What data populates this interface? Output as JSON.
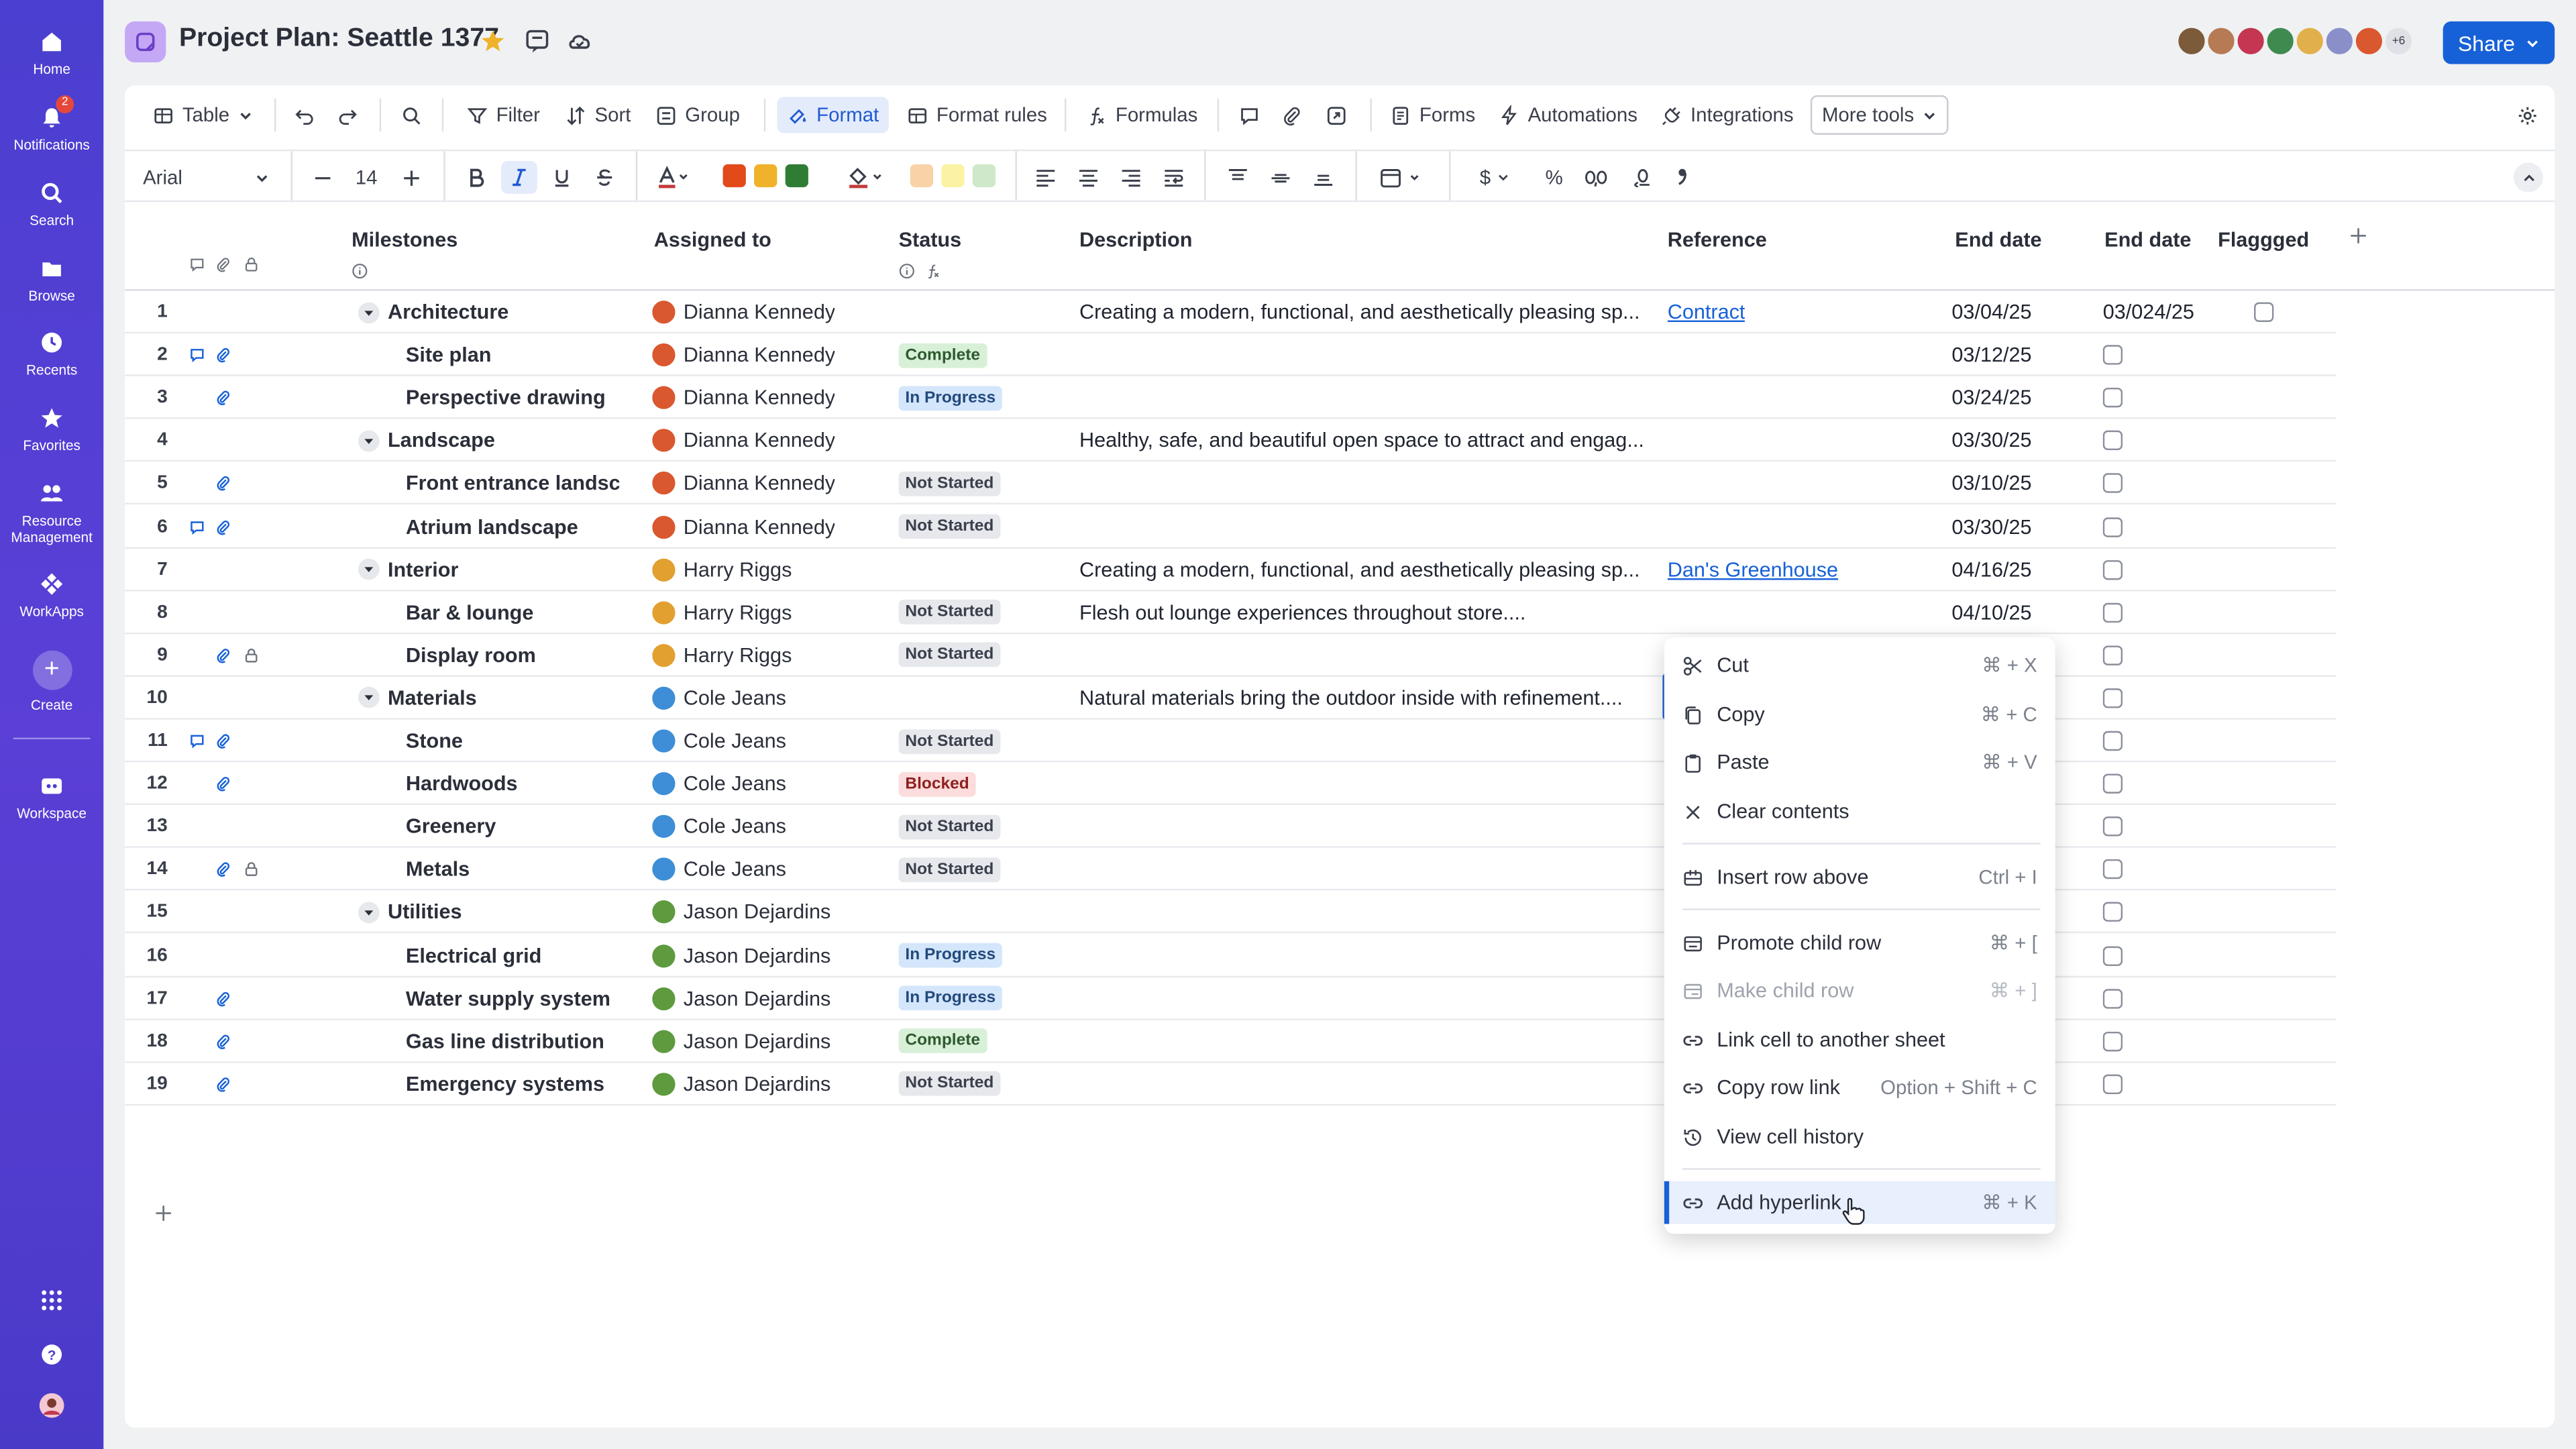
{
  "rail": {
    "home": "Home",
    "notifications": "Notifications",
    "notif_count": "2",
    "search": "Search",
    "browse": "Browse",
    "recents": "Recents",
    "favorites": "Favorites",
    "resource_management": "Resource Management",
    "workapps": "WorkApps",
    "create": "Create",
    "workspace": "Workspace"
  },
  "header": {
    "title": "Project Plan: Seattle 1377",
    "avatar_overflow": "+6",
    "share_label": "Share"
  },
  "toolbar": {
    "view": "Table",
    "filter": "Filter",
    "sort": "Sort",
    "group": "Group",
    "format": "Format",
    "format_rules": "Format rules",
    "formulas": "Formulas",
    "forms": "Forms",
    "automations": "Automations",
    "integrations": "Integrations",
    "more_tools": "More tools"
  },
  "format_bar": {
    "font": "Arial",
    "size": "14",
    "text_colors": [
      "#e24a1a",
      "#f0b22a",
      "#2f7d34"
    ],
    "fill_colors": [
      "#f8d3a8",
      "#fbf3a3",
      "#cfe8c9"
    ],
    "currency_symbol": "$",
    "percent_symbol": "%"
  },
  "columns": {
    "milestones": "Milestones",
    "assigned": "Assigned to",
    "status": "Status",
    "description": "Description",
    "reference": "Reference",
    "end_date_1": "End date",
    "end_date_2": "End date",
    "flagged": "Flaggged"
  },
  "rows": [
    {
      "num": "1",
      "name": "Architecture",
      "parent": true,
      "person": "Dianna Kennedy",
      "status": "",
      "desc": "Creating a modern, functional, and aesthetically pleasing sp...",
      "ref": "Contract",
      "date1": "03/04/25",
      "date2": "03/024/25"
    },
    {
      "num": "2",
      "name": "Site plan",
      "parent": false,
      "person": "Dianna Kennedy",
      "status": "Complete",
      "desc": "",
      "ref": "",
      "date1": "03/12/25",
      "date2": ""
    },
    {
      "num": "3",
      "name": "Perspective drawing",
      "parent": false,
      "person": "Dianna Kennedy",
      "status": "In Progress",
      "desc": "",
      "ref": "",
      "date1": "03/24/25",
      "date2": ""
    },
    {
      "num": "4",
      "name": "Landscape",
      "parent": true,
      "person": "Dianna Kennedy",
      "status": "",
      "desc": "Healthy, safe, and beautiful open space to attract and engag...",
      "ref": "",
      "date1": "03/30/25",
      "date2": ""
    },
    {
      "num": "5",
      "name": "Front entrance landsca",
      "parent": false,
      "person": "Dianna Kennedy",
      "status": "Not Started",
      "desc": "",
      "ref": "",
      "date1": "03/10/25",
      "date2": ""
    },
    {
      "num": "6",
      "name": "Atrium landscape",
      "parent": false,
      "person": "Dianna Kennedy",
      "status": "Not Started",
      "desc": "",
      "ref": "",
      "date1": "03/30/25",
      "date2": ""
    },
    {
      "num": "7",
      "name": "Interior",
      "parent": true,
      "person": "Harry Riggs",
      "status": "",
      "desc": "Creating a modern, functional, and aesthetically pleasing sp...",
      "ref": "Dan's Greenhouse",
      "date1": "04/16/25",
      "date2": ""
    },
    {
      "num": "8",
      "name": "Bar & lounge",
      "parent": false,
      "person": "Harry Riggs",
      "status": "Not Started",
      "desc": "Flesh out lounge experiences throughout store....",
      "ref": "",
      "date1": "04/10/25",
      "date2": ""
    },
    {
      "num": "9",
      "name": "Display room",
      "parent": false,
      "person": "Harry Riggs",
      "status": "Not Started",
      "desc": "",
      "ref": "",
      "date1": "",
      "date2": ""
    },
    {
      "num": "10",
      "name": "Materials",
      "parent": true,
      "person": "Cole Jeans",
      "status": "",
      "desc": "Natural materials bring the outdoor inside with refinement....",
      "ref": "",
      "date1": "",
      "date2": ""
    },
    {
      "num": "11",
      "name": "Stone",
      "parent": false,
      "person": "Cole Jeans",
      "status": "Not Started",
      "desc": "",
      "ref": "",
      "date1": "",
      "date2": ""
    },
    {
      "num": "12",
      "name": "Hardwoods",
      "parent": false,
      "person": "Cole Jeans",
      "status": "Blocked",
      "desc": "",
      "ref": "",
      "date1": "",
      "date2": ""
    },
    {
      "num": "13",
      "name": "Greenery",
      "parent": false,
      "person": "Cole Jeans",
      "status": "Not Started",
      "desc": "",
      "ref": "",
      "date1": "",
      "date2": ""
    },
    {
      "num": "14",
      "name": "Metals",
      "parent": false,
      "person": "Cole Jeans",
      "status": "Not Started",
      "desc": "",
      "ref": "",
      "date1": "",
      "date2": ""
    },
    {
      "num": "15",
      "name": "Utilities",
      "parent": true,
      "person": "Jason Dejardins",
      "status": "",
      "desc": "",
      "ref": "",
      "date1": "",
      "date2": ""
    },
    {
      "num": "16",
      "name": "Electrical grid",
      "parent": false,
      "person": "Jason Dejardins",
      "status": "In Progress",
      "desc": "",
      "ref": "",
      "date1": "",
      "date2": ""
    },
    {
      "num": "17",
      "name": "Water supply system",
      "parent": false,
      "person": "Jason Dejardins",
      "status": "In Progress",
      "desc": "",
      "ref": "",
      "date1": "",
      "date2": ""
    },
    {
      "num": "18",
      "name": "Gas line distribution",
      "parent": false,
      "person": "Jason Dejardins",
      "status": "Complete",
      "desc": "",
      "ref": "",
      "date1": "",
      "date2": ""
    },
    {
      "num": "19",
      "name": "Emergency systems",
      "parent": false,
      "person": "Jason Dejardins",
      "status": "Not Started",
      "desc": "",
      "ref": "",
      "date1": "",
      "date2": ""
    }
  ],
  "menu": {
    "cut": "Cut",
    "cut_sc": "⌘ + X",
    "copy": "Copy",
    "copy_sc": "⌘ + C",
    "paste": "Paste",
    "paste_sc": "⌘ + V",
    "clear": "Clear contents",
    "insert_above": "Insert row above",
    "insert_above_sc": "Ctrl + I",
    "promote": "Promote child row",
    "promote_sc": "⌘ + [",
    "make_child": "Make child row",
    "make_child_sc": "⌘ + ]",
    "link_cell": "Link cell to another sheet",
    "copy_row_link": "Copy row link",
    "copy_row_link_sc": "Option + Shift + C",
    "history": "View cell history",
    "hyperlink": "Add hyperlink",
    "hyperlink_sc": "⌘ + K"
  },
  "colors": {
    "rail": "#4a3fd0",
    "accent": "#1761d8",
    "complete": "#d8f0d8",
    "in_progress": "#d4e6fb",
    "not_started": "#e6e8ec",
    "blocked": "#fcdcdc"
  }
}
